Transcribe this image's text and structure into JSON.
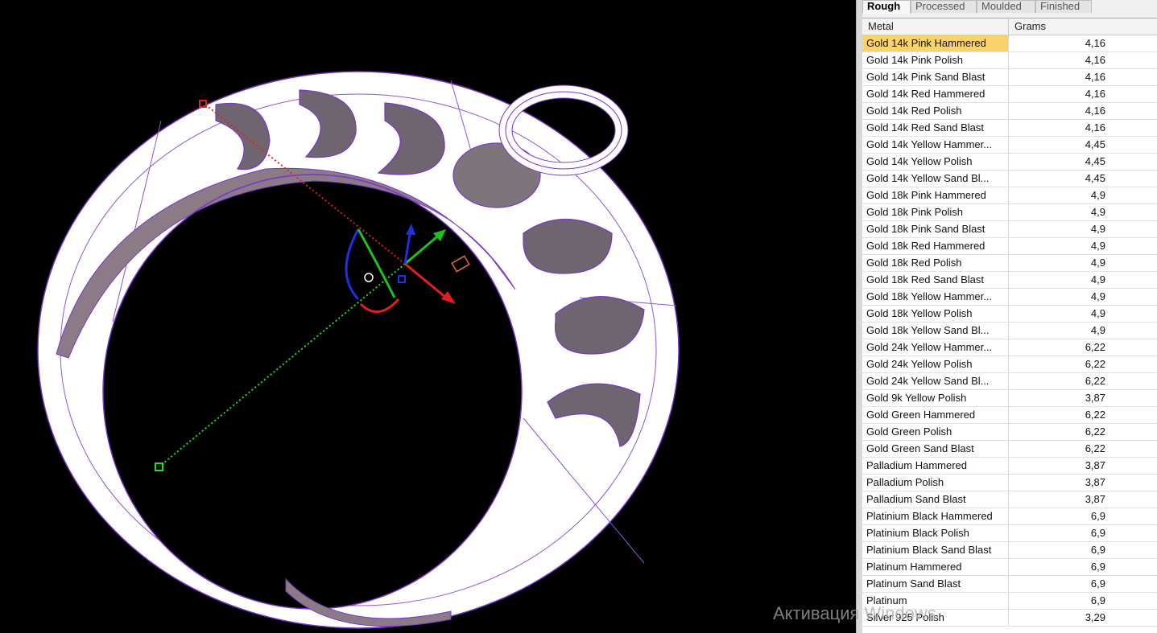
{
  "panel": {
    "tabs": [
      {
        "label": "Rough",
        "active": true
      },
      {
        "label": "Processed",
        "active": false
      },
      {
        "label": "Moulded",
        "active": false
      },
      {
        "label": "Finished",
        "active": false
      }
    ],
    "columns": {
      "metal": "Metal",
      "grams": "Grams"
    },
    "selected_row": "Gold 14k Pink Hammered",
    "rows": [
      {
        "metal": "Gold 14k Pink Hammered",
        "grams": "4,16"
      },
      {
        "metal": "Gold 14k Pink Polish",
        "grams": "4,16"
      },
      {
        "metal": "Gold 14k Pink Sand Blast",
        "grams": "4,16"
      },
      {
        "metal": "Gold 14k Red Hammered",
        "grams": "4,16"
      },
      {
        "metal": "Gold 14k Red Polish",
        "grams": "4,16"
      },
      {
        "metal": "Gold 14k Red Sand Blast",
        "grams": "4,16"
      },
      {
        "metal": "Gold 14k Yellow Hammer...",
        "grams": "4,45"
      },
      {
        "metal": "Gold 14k Yellow Polish",
        "grams": "4,45"
      },
      {
        "metal": "Gold 14k Yellow Sand Bl...",
        "grams": "4,45"
      },
      {
        "metal": "Gold 18k Pink Hammered",
        "grams": "4,9"
      },
      {
        "metal": "Gold 18k Pink Polish",
        "grams": "4,9"
      },
      {
        "metal": "Gold 18k Pink Sand Blast",
        "grams": "4,9"
      },
      {
        "metal": "Gold 18k Red Hammered",
        "grams": "4,9"
      },
      {
        "metal": "Gold 18k Red Polish",
        "grams": "4,9"
      },
      {
        "metal": "Gold 18k Red Sand Blast",
        "grams": "4,9"
      },
      {
        "metal": "Gold 18k Yellow Hammer...",
        "grams": "4,9"
      },
      {
        "metal": "Gold 18k Yellow Polish",
        "grams": "4,9"
      },
      {
        "metal": "Gold 18k Yellow Sand Bl...",
        "grams": "4,9"
      },
      {
        "metal": "Gold 24k Yellow Hammer...",
        "grams": "6,22"
      },
      {
        "metal": "Gold 24k Yellow Polish",
        "grams": "6,22"
      },
      {
        "metal": "Gold 24k Yellow Sand Bl...",
        "grams": "6,22"
      },
      {
        "metal": "Gold 9k Yellow Polish",
        "grams": "3,87"
      },
      {
        "metal": "Gold Green Hammered",
        "grams": "6,22"
      },
      {
        "metal": "Gold Green Polish",
        "grams": "6,22"
      },
      {
        "metal": "Gold Green Sand Blast",
        "grams": "6,22"
      },
      {
        "metal": "Palladium Hammered",
        "grams": "3,87"
      },
      {
        "metal": "Palladium Polish",
        "grams": "3,87"
      },
      {
        "metal": "Palladium Sand Blast",
        "grams": "3,87"
      },
      {
        "metal": "Platinium Black Hammered",
        "grams": "6,9"
      },
      {
        "metal": "Platinium Black Polish",
        "grams": "6,9"
      },
      {
        "metal": "Platinium Black Sand Blast",
        "grams": "6,9"
      },
      {
        "metal": "Platinum Hammered",
        "grams": "6,9"
      },
      {
        "metal": "Platinum Sand Blast",
        "grams": "6,9"
      },
      {
        "metal": "Platinum",
        "grams": "6,9"
      },
      {
        "metal": "Silver 925 Polish",
        "grams": "3,29"
      }
    ]
  },
  "watermark": "Активация Windows",
  "colors": {
    "selection": "#fbd36b",
    "wireframe": "#7a35c8",
    "axis_x": "#e02020",
    "axis_y": "#20c020",
    "axis_z": "#2030e0"
  }
}
